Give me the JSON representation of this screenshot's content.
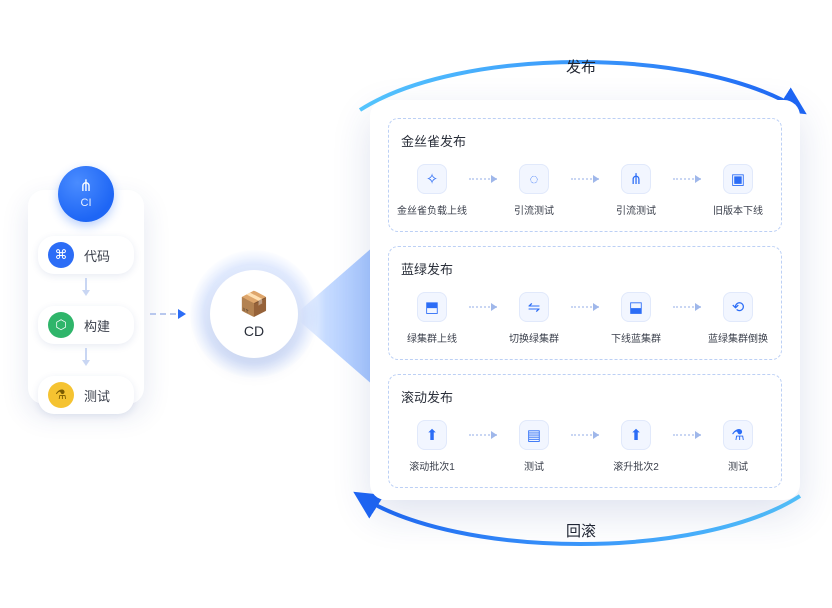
{
  "ci": {
    "badge_label": "CI",
    "items": [
      {
        "label": "代码",
        "icon": "code-icon"
      },
      {
        "label": "构建",
        "icon": "build-icon"
      },
      {
        "label": "测试",
        "icon": "flask-icon"
      }
    ]
  },
  "cd": {
    "label": "CD",
    "icon": "deploy-box-icon"
  },
  "labels": {
    "release": "发布",
    "rollback": "回滚"
  },
  "deploy": {
    "sections": [
      {
        "title": "金丝雀发布",
        "steps": [
          {
            "label": "金丝雀负载上线",
            "icon": "canary-bird-icon"
          },
          {
            "label": "引流测试",
            "icon": "flow-cycle-icon"
          },
          {
            "label": "引流测试",
            "icon": "network-icon"
          },
          {
            "label": "旧版本下线",
            "icon": "archive-icon"
          }
        ]
      },
      {
        "title": "蓝绿发布",
        "steps": [
          {
            "label": "绿集群上线",
            "icon": "cluster-up-icon"
          },
          {
            "label": "切换绿集群",
            "icon": "switch-icon"
          },
          {
            "label": "下线蓝集群",
            "icon": "cluster-down-icon"
          },
          {
            "label": "蓝绿集群倒换",
            "icon": "swap-icon"
          }
        ]
      },
      {
        "title": "滚动发布",
        "steps": [
          {
            "label": "滚动批次1",
            "icon": "batch-up-icon"
          },
          {
            "label": "测试",
            "icon": "clipboard-icon"
          },
          {
            "label": "滚升批次2",
            "icon": "batch-up-icon"
          },
          {
            "label": "测试",
            "icon": "flask-icon"
          }
        ]
      }
    ]
  },
  "glyphs": {
    "code-icon": "⌘",
    "build-icon": "⬡",
    "flask-icon": "⚗",
    "deploy-box-icon": "📦",
    "branch-icon": "⋔",
    "canary-bird-icon": "✧",
    "flow-cycle-icon": "◌",
    "network-icon": "⋔",
    "archive-icon": "▣",
    "cluster-up-icon": "⬒",
    "switch-icon": "⇋",
    "cluster-down-icon": "⬓",
    "swap-icon": "⟲",
    "batch-up-icon": "⬆",
    "clipboard-icon": "▤"
  }
}
